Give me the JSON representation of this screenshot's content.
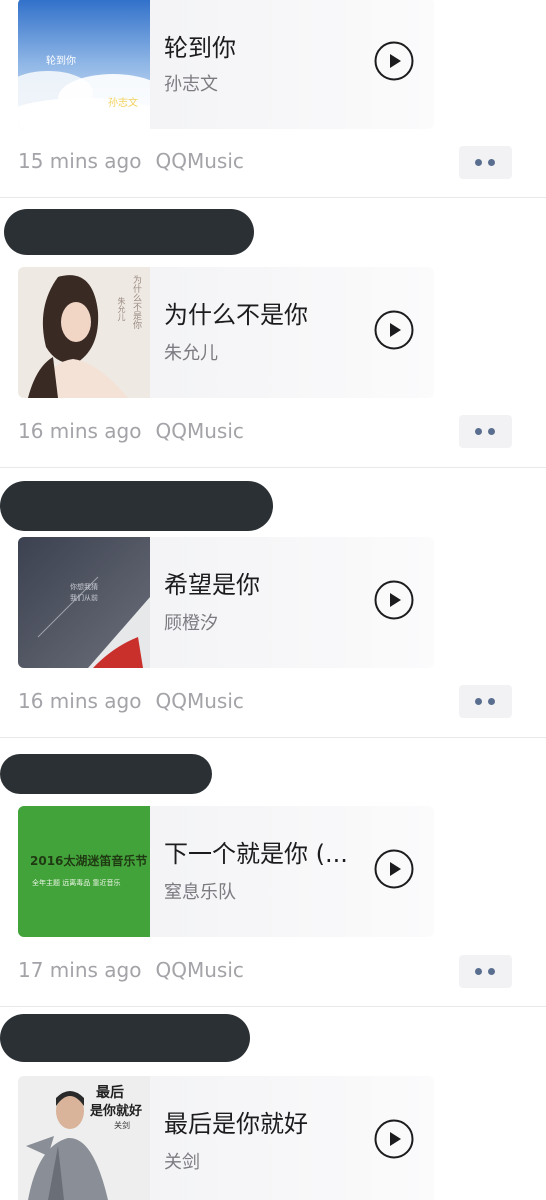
{
  "posts": [
    {
      "song": {
        "title": "轮到你",
        "artist": "孙志文"
      },
      "cover_text": [
        "轮到你",
        "孙志文"
      ],
      "time": "15 mins ago",
      "source": "QQMusic"
    },
    {
      "song": {
        "title": "为什么不是你",
        "artist": "朱允儿"
      },
      "cover_text": [
        "为什么不是你",
        "朱允儿"
      ],
      "time": "16 mins ago",
      "source": "QQMusic"
    },
    {
      "song": {
        "title": "希望是你",
        "artist": "顾橙汐"
      },
      "cover_text": [
        "你想我猜",
        "我们从前"
      ],
      "time": "16 mins ago",
      "source": "QQMusic"
    },
    {
      "song": {
        "title": "下一个就是你 (...",
        "artist": "窒息乐队"
      },
      "cover_text": [
        "2016太湖迷笛音乐节",
        "全年主题  远离毒品 靠近音乐"
      ],
      "time": "17 mins ago",
      "source": "QQMusic"
    },
    {
      "song": {
        "title": "最后是你就好",
        "artist": "关剑"
      },
      "cover_text": [
        "最后",
        "是你就好",
        "关剑"
      ],
      "time": "",
      "source": ""
    }
  ],
  "icons": {
    "play": "play-icon",
    "more": "more-dots-icon"
  },
  "colors": {
    "redacted_bar": "#2b3034",
    "meta_text": "#a3a3a8",
    "more_dots": "#5a6f8f"
  }
}
